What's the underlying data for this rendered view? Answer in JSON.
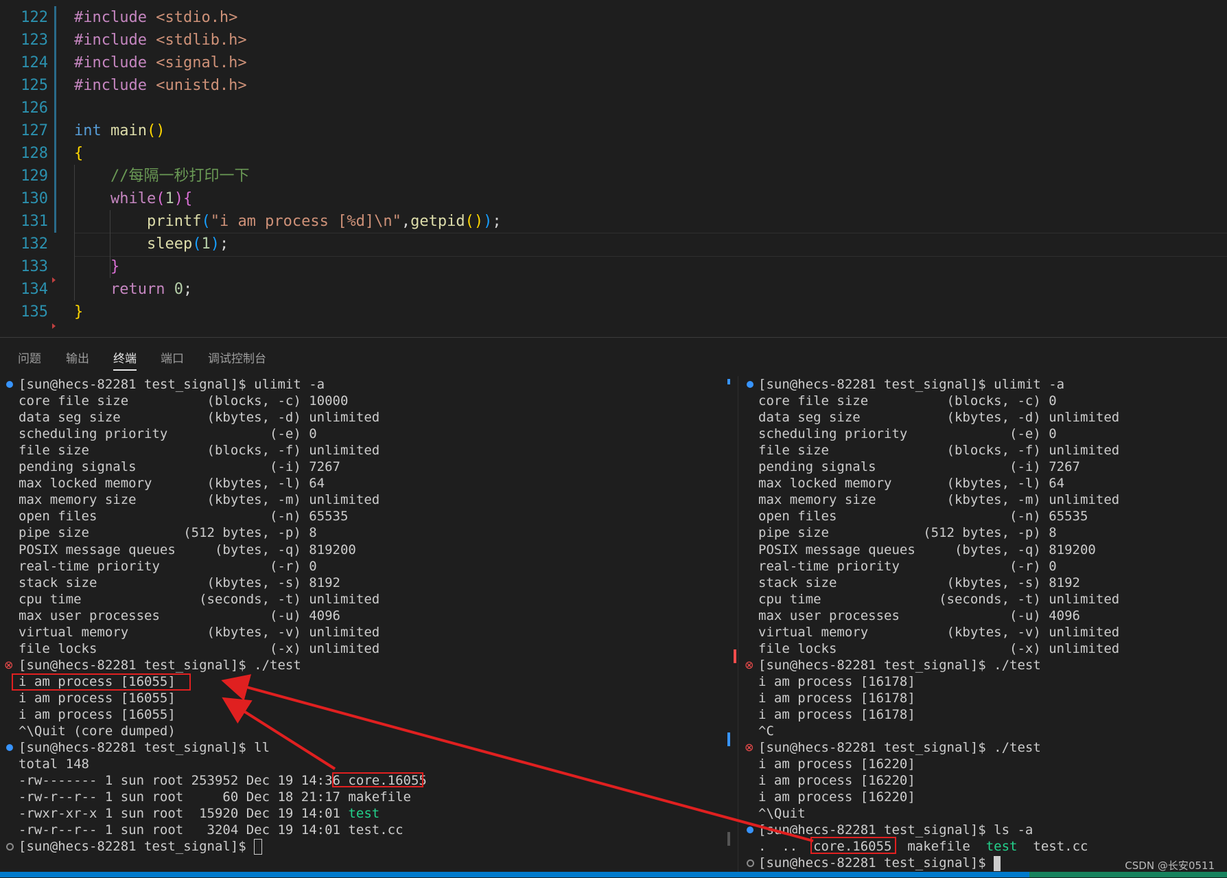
{
  "editor": {
    "lines": [
      {
        "n": "122",
        "parts": [
          [
            "kw-inc",
            "#include "
          ],
          [
            "str",
            "<stdio.h>"
          ]
        ]
      },
      {
        "n": "123",
        "parts": [
          [
            "kw-inc",
            "#include "
          ],
          [
            "str",
            "<stdlib.h>"
          ]
        ]
      },
      {
        "n": "124",
        "parts": [
          [
            "kw-inc",
            "#include "
          ],
          [
            "str",
            "<signal.h>"
          ]
        ]
      },
      {
        "n": "125",
        "parts": [
          [
            "kw-inc",
            "#include "
          ],
          [
            "str",
            "<unistd.h>"
          ]
        ]
      },
      {
        "n": "126",
        "parts": []
      },
      {
        "n": "127",
        "parts": [
          [
            "kw",
            "int "
          ],
          [
            "fn",
            "main"
          ],
          [
            "br1",
            "()"
          ]
        ]
      },
      {
        "n": "128",
        "parts": [
          [
            "br1",
            "{"
          ]
        ]
      },
      {
        "n": "129",
        "parts": [
          [
            "pl",
            "    "
          ],
          [
            "cmt",
            "//每隔一秒打印一下"
          ]
        ]
      },
      {
        "n": "130",
        "parts": [
          [
            "pl",
            "    "
          ],
          [
            "kw-ctl",
            "while"
          ],
          [
            "br2",
            "("
          ],
          [
            "num",
            "1"
          ],
          [
            "br2",
            ")"
          ],
          [
            "br2",
            "{"
          ]
        ]
      },
      {
        "n": "131",
        "parts": [
          [
            "pl",
            "        "
          ],
          [
            "fn",
            "printf"
          ],
          [
            "br3",
            "("
          ],
          [
            "str",
            "\"i am process [%d]\\n\""
          ],
          [
            "pl",
            ","
          ],
          [
            "fn",
            "getpid"
          ],
          [
            "br1",
            "()"
          ],
          [
            "br3",
            ")"
          ],
          [
            "pl",
            ";"
          ]
        ]
      },
      {
        "n": "132",
        "parts": [
          [
            "pl",
            "        "
          ],
          [
            "fn",
            "sleep"
          ],
          [
            "br3",
            "("
          ],
          [
            "num",
            "1"
          ],
          [
            "br3",
            ")"
          ],
          [
            "pl",
            ";"
          ]
        ]
      },
      {
        "n": "133",
        "parts": [
          [
            "pl",
            "    "
          ],
          [
            "br2",
            "}"
          ]
        ]
      },
      {
        "n": "134",
        "parts": [
          [
            "pl",
            "    "
          ],
          [
            "kw-ctl",
            "return "
          ],
          [
            "num",
            "0"
          ],
          [
            "pl",
            ";"
          ]
        ]
      },
      {
        "n": "135",
        "parts": [
          [
            "br1",
            "}"
          ]
        ]
      }
    ]
  },
  "panel": {
    "tabs": [
      "问题",
      "输出",
      "终端",
      "端口",
      "调试控制台"
    ],
    "active_tab": "终端"
  },
  "terminal_left": [
    {
      "m": "blue",
      "t": "[sun@hecs-82281 test_signal]$ ulimit -a"
    },
    {
      "t": "core file size          (blocks, -c) 10000"
    },
    {
      "t": "data seg size           (kbytes, -d) unlimited"
    },
    {
      "t": "scheduling priority             (-e) 0"
    },
    {
      "t": "file size               (blocks, -f) unlimited"
    },
    {
      "t": "pending signals                 (-i) 7267"
    },
    {
      "t": "max locked memory       (kbytes, -l) 64"
    },
    {
      "t": "max memory size         (kbytes, -m) unlimited"
    },
    {
      "t": "open files                      (-n) 65535"
    },
    {
      "t": "pipe size            (512 bytes, -p) 8"
    },
    {
      "t": "POSIX message queues     (bytes, -q) 819200"
    },
    {
      "t": "real-time priority              (-r) 0"
    },
    {
      "t": "stack size              (kbytes, -s) 8192"
    },
    {
      "t": "cpu time               (seconds, -t) unlimited"
    },
    {
      "t": "max user processes              (-u) 4096"
    },
    {
      "t": "virtual memory          (kbytes, -v) unlimited"
    },
    {
      "t": "file locks                      (-x) unlimited"
    },
    {
      "m": "err",
      "t": "[sun@hecs-82281 test_signal]$ ./test"
    },
    {
      "t": "i am process [16055]"
    },
    {
      "t": "i am process [16055]"
    },
    {
      "t": "i am process [16055]"
    },
    {
      "t": "^\\Quit (core dumped)"
    },
    {
      "m": "blue",
      "t": "[sun@hecs-82281 test_signal]$ ll"
    },
    {
      "t": "total 148"
    },
    {
      "t": "-rw------- 1 sun root 253952 Dec 19 14:36 core.16055"
    },
    {
      "t": "-rw-r--r-- 1 sun root     60 Dec 18 21:17 makefile"
    },
    {
      "t": "-rwxr-xr-x 1 sun root  15920 Dec 19 14:01 ",
      "g": "test"
    },
    {
      "t": "-rw-r--r-- 1 sun root   3204 Dec 19 14:01 test.cc"
    },
    {
      "m": "hollow",
      "t": "[sun@hecs-82281 test_signal]$ ",
      "c": "box"
    }
  ],
  "terminal_right": [
    {
      "m": "blue",
      "t": "[sun@hecs-82281 test_signal]$ ulimit -a"
    },
    {
      "t": "core file size          (blocks, -c) 0"
    },
    {
      "t": "data seg size           (kbytes, -d) unlimited"
    },
    {
      "t": "scheduling priority             (-e) 0"
    },
    {
      "t": "file size               (blocks, -f) unlimited"
    },
    {
      "t": "pending signals                 (-i) 7267"
    },
    {
      "t": "max locked memory       (kbytes, -l) 64"
    },
    {
      "t": "max memory size         (kbytes, -m) unlimited"
    },
    {
      "t": "open files                      (-n) 65535"
    },
    {
      "t": "pipe size            (512 bytes, -p) 8"
    },
    {
      "t": "POSIX message queues     (bytes, -q) 819200"
    },
    {
      "t": "real-time priority              (-r) 0"
    },
    {
      "t": "stack size              (kbytes, -s) 8192"
    },
    {
      "t": "cpu time               (seconds, -t) unlimited"
    },
    {
      "t": "max user processes              (-u) 4096"
    },
    {
      "t": "virtual memory          (kbytes, -v) unlimited"
    },
    {
      "t": "file locks                      (-x) unlimited"
    },
    {
      "m": "err",
      "t": "[sun@hecs-82281 test_signal]$ ./test"
    },
    {
      "t": "i am process [16178]"
    },
    {
      "t": "i am process [16178]"
    },
    {
      "t": "i am process [16178]"
    },
    {
      "t": "^C"
    },
    {
      "m": "err",
      "t": "[sun@hecs-82281 test_signal]$ ./test"
    },
    {
      "t": "i am process [16220]"
    },
    {
      "t": "i am process [16220]"
    },
    {
      "t": "i am process [16220]"
    },
    {
      "t": "^\\Quit"
    },
    {
      "m": "blue",
      "t": "[sun@hecs-82281 test_signal]$ ls -a"
    },
    {
      "t": ".  ..  core.16055  makefile  ",
      "g": "test",
      "t2": "  test.cc"
    },
    {
      "m": "hollow",
      "t": "[sun@hecs-82281 test_signal]$ ",
      "c": "solid"
    }
  ],
  "watermark": "CSDN @长安0511",
  "colors": {
    "accent": "#007acc",
    "annotation": "#e02020",
    "exec_green": "#23d18b"
  }
}
